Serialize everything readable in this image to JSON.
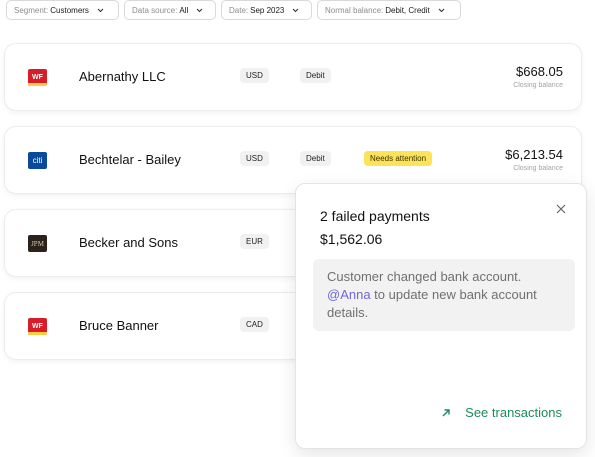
{
  "filters": [
    {
      "label": "Segment:",
      "value": "Customers"
    },
    {
      "label": "Data source:",
      "value": "All"
    },
    {
      "label": "Date:",
      "value": "Sep 2023"
    },
    {
      "label": "Normal balance:",
      "value": "Debit, Credit"
    }
  ],
  "rows": [
    {
      "logo": "WF",
      "name": "Abernathy LLC",
      "currency": "USD",
      "type": "Debit",
      "status": "",
      "amount": "$668.05",
      "amount_label": "Closing balance"
    },
    {
      "logo": "citi",
      "name": "Bechtelar - Bailey",
      "currency": "USD",
      "type": "Debit",
      "status": "Needs attention",
      "amount": "$6,213.54",
      "amount_label": "Closing balance"
    },
    {
      "logo": "JPM",
      "name": "Becker and Sons",
      "currency": "EUR"
    },
    {
      "logo": "WF",
      "name": "Bruce Banner",
      "currency": "CAD"
    }
  ],
  "popover": {
    "title": "2 failed payments",
    "amount": "$1,562.06",
    "note_before": "Customer changed bank account. ",
    "mention": "@Anna",
    "note_after": " to update new bank account details.",
    "link": "See transactions"
  },
  "colors": {
    "attention": "#fde35a",
    "link": "#1f8a5b",
    "mention": "#7068d6",
    "wf_red": "#d71e28",
    "citi_blue": "#0a4a9c"
  }
}
